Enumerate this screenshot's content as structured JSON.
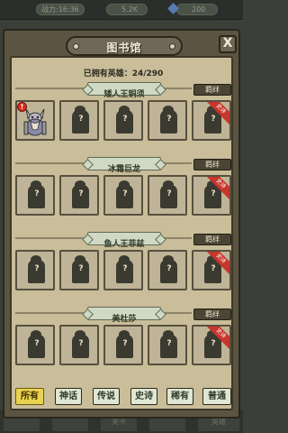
{
  "topbar": {
    "power_text": "战力:16:36",
    "coin_text": "5.2K",
    "gem_text": "200"
  },
  "panel": {
    "title": "图书馆",
    "close": "X",
    "owned_label": "已拥有英雄：",
    "owned_count": "24/290"
  },
  "bond_label": "羁绊",
  "ribbon_label": "史诗",
  "slot_unknown": "?",
  "sections": [
    {
      "name": "矮人王铜须"
    },
    {
      "name": "冰霜巨龙"
    },
    {
      "name": "鱼人王菲兹"
    },
    {
      "name": "美杜莎"
    }
  ],
  "filters": [
    {
      "label": "所有",
      "active": true
    },
    {
      "label": "神话",
      "active": false
    },
    {
      "label": "传说",
      "active": false
    },
    {
      "label": "史诗",
      "active": false
    },
    {
      "label": "稀有",
      "active": false
    },
    {
      "label": "普通",
      "active": false
    }
  ],
  "alert_mark": "!",
  "bottom_tabs": [
    "",
    "",
    "关卡",
    "",
    "英雄"
  ]
}
